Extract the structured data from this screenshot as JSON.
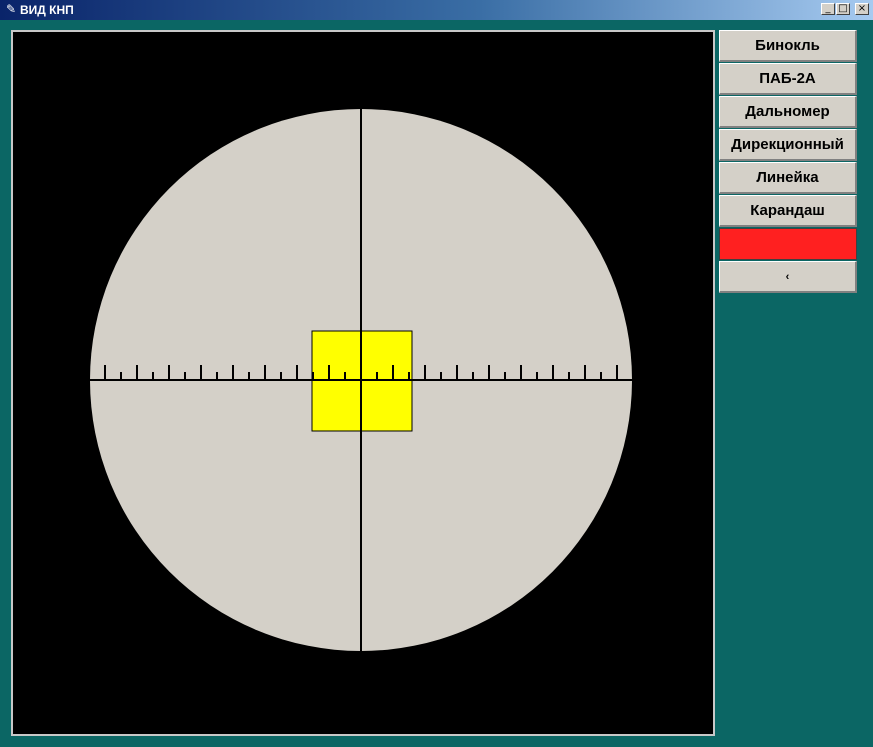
{
  "window": {
    "title": "ВИД КНП",
    "icon": "feather-icon"
  },
  "buttons": [
    {
      "label": "Бинокль"
    },
    {
      "label": "ПАБ-2А"
    },
    {
      "label": "Дальномер"
    },
    {
      "label": "Дирекционный"
    },
    {
      "label": "Линейка"
    },
    {
      "label": "Карандаш"
    },
    {
      "label": "",
      "color": "#ff2020"
    },
    {
      "label": "‹"
    }
  ],
  "colors": {
    "background": "#0b6664",
    "viewport": "#000000",
    "lens": "#d4d0c8",
    "target": "#ffff00",
    "color_button": "#ff2020"
  }
}
